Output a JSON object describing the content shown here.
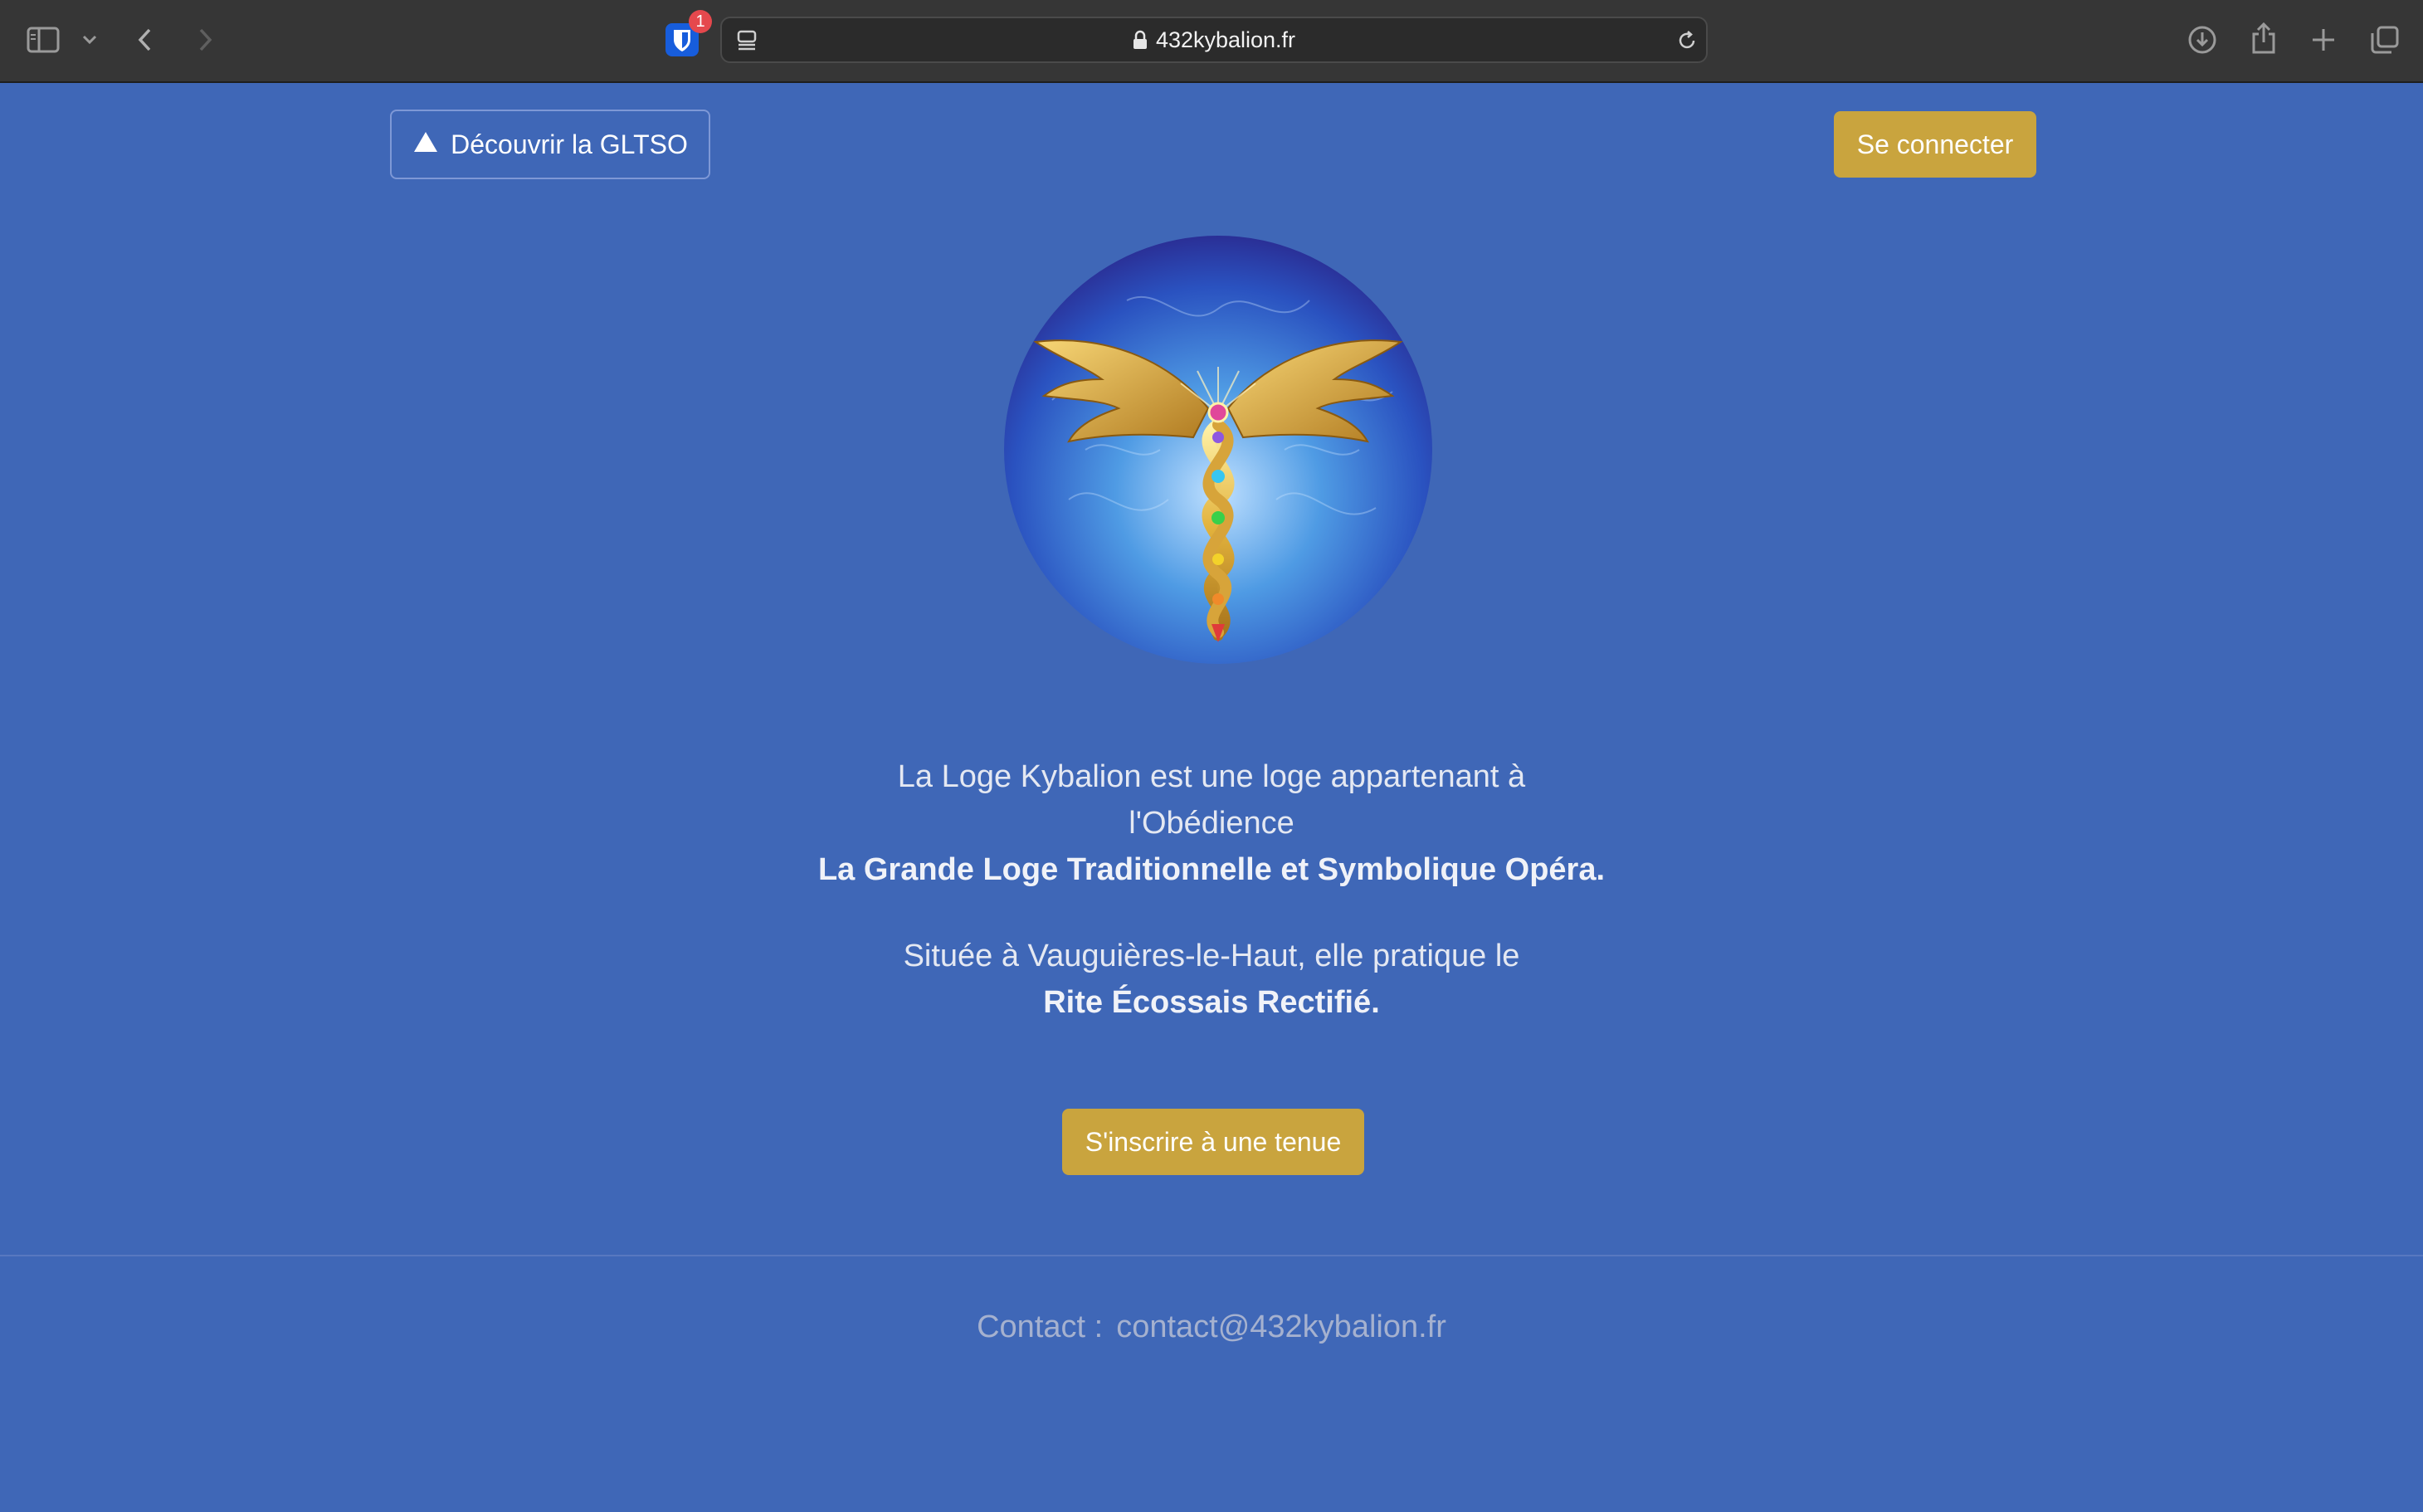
{
  "browser": {
    "url": "432kybalion.fr",
    "extension_badge": "1",
    "icons": [
      "sidebar-icon",
      "chevron-down-icon",
      "back-icon",
      "forward-icon",
      "bitwarden-shield-icon",
      "page-menu-icon",
      "lock-icon",
      "reload-icon",
      "download-icon",
      "share-icon",
      "new-tab-icon",
      "tabs-overview-icon"
    ]
  },
  "header": {
    "discover_label": "Découvrir la GLTSO",
    "login_label": "Se connecter"
  },
  "intro": {
    "line1": "La Loge Kybalion est une loge appartenant à",
    "line2": "l'Obédience",
    "line3": "La Grande Loge Traditionnelle et Symbolique Opéra.",
    "line4": "Située à Vauguières-le-Haut, elle pratique le",
    "line5": "Rite Écossais Rectifié."
  },
  "cta": {
    "register_label": "S'inscrire à une tenue"
  },
  "footer": {
    "contact_label": "Contact :",
    "contact_email": "contact@432kybalion.fr"
  },
  "colors": {
    "page_background": "#3f67b7",
    "gold_button": "#c9a43e",
    "toolbar": "#363636"
  }
}
